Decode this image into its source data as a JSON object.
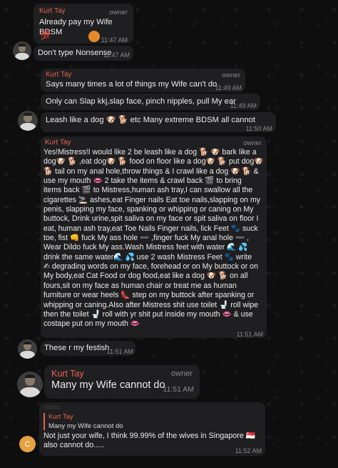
{
  "messages": {
    "m1": {
      "sender": "Kurt Tay",
      "role": "owner",
      "text": "Already pay my Wife BDSM",
      "reaction": "💯",
      "time": "11:47 AM"
    },
    "m2": {
      "text": "Don't type Nonsense",
      "time": "11:47 AM"
    },
    "m3": {
      "sender": "Kurt Tay",
      "role": "owner",
      "text": "Says many times a lot of things my Wife can't do",
      "time": "11:49 AM"
    },
    "m4": {
      "text": "Only can Slap kkj,slap face, pinch nipples, pull My ear",
      "time": "11:49 AM"
    },
    "m5": {
      "text": "Leash like a dog 🐶 🐕 etc Many extreme BDSM all cannot",
      "time": "11:50 AM"
    },
    "m6": {
      "sender": "Kurt Tay",
      "role": "owner",
      "text": "Yes!Mistress!I would like 2 be leash like a dog 🐕 🐶 bark like a\ndog🐶 🐕 ,eat dog🐶 🐕 food on floor like a dog🐶 🐕 put dog🐶\n🐕 tail on my anal hole,throw things & I crawl like a dog 🐶 🐕 &\nuse my mouth 👄 2 take the items & crawl back 🎬 to bring\nitems back 🎬 to Mistress,human ash tray,I can swallow all the\ncigarettes 🚬 ashes,eat Finger nails Eat toe nails,slapping on my\npenis, slapping my face, spanking or whipping or caning on My\nbuttock, Drink urine,spit saliva on my face or spit saliva on floor I\neat, human ash tray,eat Toe Nails Finger nails, lick Feet 🐾 suck\ntoe, fist 👊 fuck My ass hole ➖ ,finger fuck My anal hole ➖ ,\nWear Dildo fuck My ass.Wash Mistress feet with water 🌊 💦\ndrink the same water🌊 💦 use 2 wash Mistress Feet 🐾 write\n✍ degrading words on my face, forehead or on My buttock or on\nMy body,eat Cat Food or dog food,eat like a dog 🐶 🐕 on all\nfours,sit on my face as human chair or treat me as human\nfurniture or wear heels 👠 step on my buttock after spanking or\nwhipping or caning.Also after Mistress shit use toilet 🚽 roll wipe\nthen the toilet 🚽 roll with yr shit put inside my mouth 👄 & use\ncostape put on my mouth 👄",
      "time": "11:51 AM"
    },
    "m7": {
      "text": "These r my festish",
      "time": "11:51 AM"
    },
    "m8": {
      "sender": "Kurt Tay",
      "role": "owner",
      "text": "Many my Wife cannot do",
      "time": "11:51 AM"
    },
    "m9": {
      "avatar_letter": "C",
      "quote_sender": "Kurt Tay",
      "quote_text": "Many my Wife cannot do",
      "text": "Not just your wife, I think 99.99% of the wives in Singapore 🇸🇬\nalso cannot do.....",
      "time": "11:52 AM"
    }
  },
  "colors": {
    "bubble": "#1f1f21",
    "sender": "#e9624b",
    "meta": "#8a8a8a",
    "avatar_c": "#e3a13f"
  }
}
